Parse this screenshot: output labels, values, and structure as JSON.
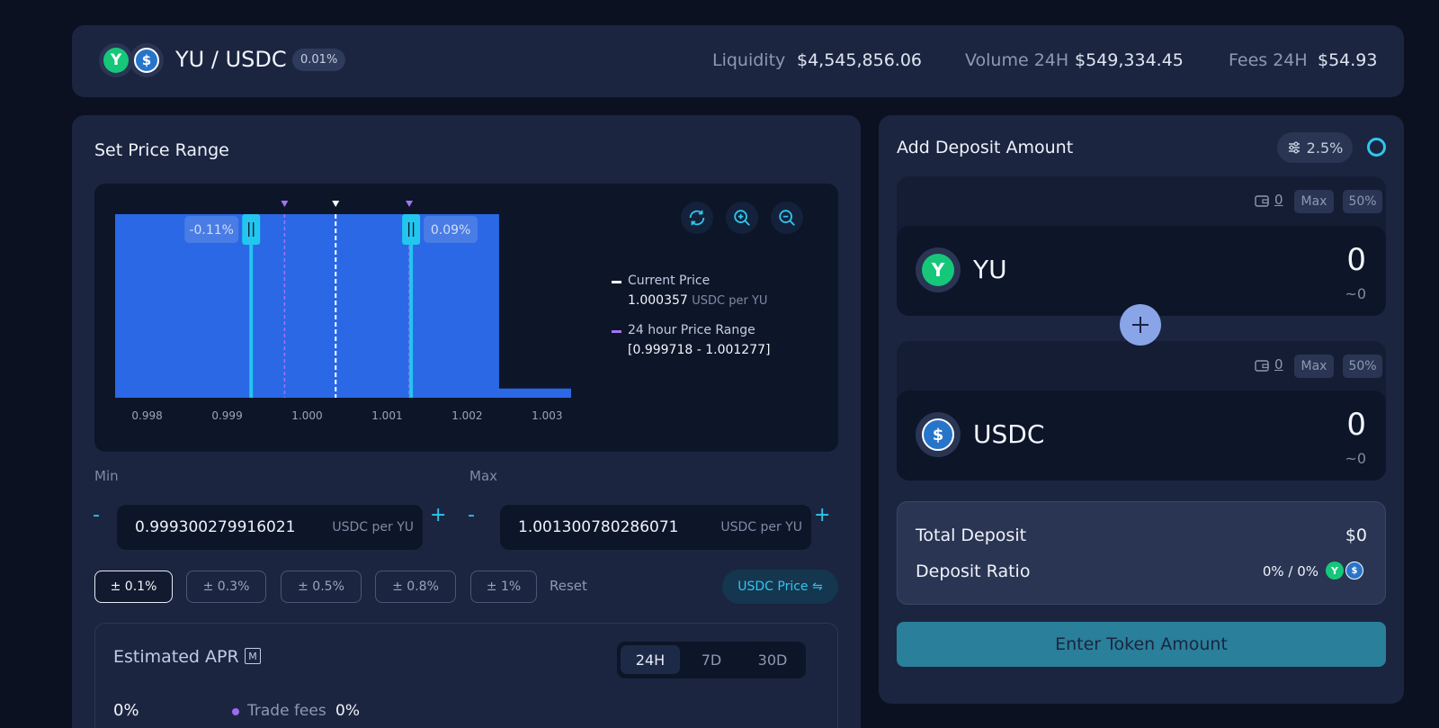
{
  "header": {
    "pair": "YU / USDC",
    "fee_tier": "0.01%",
    "liquidity_label": "Liquidity",
    "liquidity_value": "$4,545,856.06",
    "volume_label": "Volume 24H",
    "volume_value": "$549,334.45",
    "fees_label": "Fees 24H",
    "fees_value": "$54.93"
  },
  "range": {
    "title": "Set Price Range",
    "min_label": "Min",
    "min_value": "0.999300279916021",
    "max_label": "Max",
    "max_value": "1.001300780286071",
    "unit": "USDC per YU",
    "minus": "-",
    "plus": "+",
    "presets": [
      "± 0.1%",
      "± 0.3%",
      "± 0.5%",
      "± 0.8%",
      "± 1%"
    ],
    "active_preset": "± 0.1%",
    "reset_label": "Reset",
    "price_toggle": "USDC Price ⇋"
  },
  "chart_data": {
    "type": "area",
    "x_ticks": [
      "0.998",
      "0.999",
      "1.000",
      "1.001",
      "1.002",
      "1.003"
    ],
    "x": [
      0.9976,
      0.9995,
      0.9995,
      1.0024,
      1.0024,
      1.0033
    ],
    "y": [
      1.0,
      1.0,
      1.0,
      1.0,
      0.05,
      0.05
    ],
    "range_min": 0.9993,
    "range_max": 1.0013,
    "range_min_label": "-0.11%",
    "range_max_label": "0.09%",
    "current_price": 1.000357,
    "day_range": [
      0.999718,
      1.001277
    ],
    "legend": {
      "current_label": "Current Price",
      "current_value": "1.000357",
      "current_unit": "USDC per YU",
      "range_label": "24 hour Price Range",
      "range_value": "[0.999718 - 1.001277]"
    },
    "colors": {
      "liquidity": "#2a68e6",
      "handles": "#22c6ee",
      "current": "#ffffff",
      "day_range": "#a274f2"
    }
  },
  "apr": {
    "title": "Estimated APR",
    "badge": "M",
    "tabs": [
      "24H",
      "7D",
      "30D"
    ],
    "active_tab": "24H",
    "value": "0%",
    "trade_fees_label": "Trade fees",
    "trade_fees_value": "0%"
  },
  "deposit": {
    "title": "Add Deposit Amount",
    "slippage": "2.5%",
    "tokens": [
      {
        "name": "YU",
        "amount": "0",
        "usd": "~0",
        "balance": "0",
        "max": "Max",
        "half": "50%"
      },
      {
        "name": "USDC",
        "amount": "0",
        "usd": "~0",
        "balance": "0",
        "max": "Max",
        "half": "50%"
      }
    ],
    "total_label": "Total Deposit",
    "total_value": "$0",
    "ratio_label": "Deposit Ratio",
    "ratio_value": "0% / 0%",
    "cta": "Enter Token Amount"
  },
  "icons": {
    "yu_glyph": "Y",
    "usdc_glyph": "$"
  }
}
